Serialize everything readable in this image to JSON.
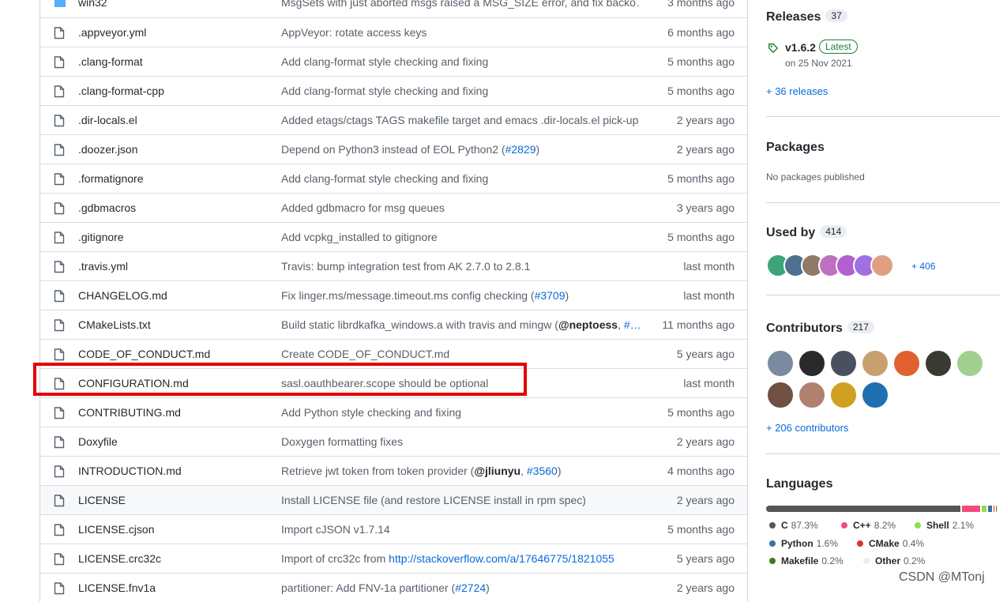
{
  "files": [
    {
      "name": "win32",
      "message": "MsgSets with just aborted msgs raised a MSG_SIZE error, and fix backo…",
      "age": "3 months ago",
      "type": "folder"
    },
    {
      "name": ".appveyor.yml",
      "message": "AppVeyor: rotate access keys",
      "age": "6 months ago"
    },
    {
      "name": ".clang-format",
      "message": "Add clang-format style checking and fixing",
      "age": "5 months ago"
    },
    {
      "name": ".clang-format-cpp",
      "message": "Add clang-format style checking and fixing",
      "age": "5 months ago"
    },
    {
      "name": ".dir-locals.el",
      "message": "Added etags/ctags TAGS makefile target and emacs .dir-locals.el pick-up",
      "age": "2 years ago"
    },
    {
      "name": ".doozer.json",
      "message": "Depend on Python3 instead of EOL Python2 (",
      "link": "#2829",
      "message_end": ")",
      "age": "2 years ago"
    },
    {
      "name": ".formatignore",
      "message": "Add clang-format style checking and fixing",
      "age": "5 months ago"
    },
    {
      "name": ".gdbmacros",
      "message": "Added gdbmacro for msg queues",
      "age": "3 years ago"
    },
    {
      "name": ".gitignore",
      "message": "Add vcpkg_installed to gitignore",
      "age": "5 months ago"
    },
    {
      "name": ".travis.yml",
      "message": "Travis: bump integration test from AK 2.7.0 to 2.8.1",
      "age": "last month"
    },
    {
      "name": "CHANGELOG.md",
      "message": "Fix linger.ms/message.timeout.ms config checking (",
      "link": "#3709",
      "message_end": ")",
      "age": "last month"
    },
    {
      "name": "CMakeLists.txt",
      "message": "Build static librdkafka_windows.a with travis and mingw (",
      "bold": "@neptoess",
      "message_mid": ", ",
      "link": "#…",
      "age": "11 months ago"
    },
    {
      "name": "CODE_OF_CONDUCT.md",
      "message": "Create CODE_OF_CONDUCT.md",
      "age": "5 years ago"
    },
    {
      "name": "CONFIGURATION.md",
      "message": "sasl.oauthbearer.scope should be optional",
      "age": "last month"
    },
    {
      "name": "CONTRIBUTING.md",
      "message": "Add Python style checking and fixing",
      "age": "5 months ago"
    },
    {
      "name": "Doxyfile",
      "message": "Doxygen formatting fixes",
      "age": "2 years ago"
    },
    {
      "name": "INTRODUCTION.md",
      "message": "Retrieve jwt token from token provider (",
      "bold": "@jliunyu",
      "message_mid": ", ",
      "link": "#3560",
      "message_end": ")",
      "age": "4 months ago"
    },
    {
      "name": "LICENSE",
      "message": "Install LICENSE file (and restore LICENSE install in rpm spec)",
      "age": "2 years ago",
      "hover": true
    },
    {
      "name": "LICENSE.cjson",
      "message": "Import cJSON v1.7.14",
      "age": "5 months ago"
    },
    {
      "name": "LICENSE.crc32c",
      "message": "Import of crc32c from ",
      "link": "http://stackoverflow.com/a/17646775/1821055",
      "age": "5 years ago"
    },
    {
      "name": "LICENSE.fnv1a",
      "message": "partitioner: Add FNV-1a partitioner (",
      "link": "#2724",
      "message_end": ")",
      "age": "2 years ago"
    }
  ],
  "sidebar": {
    "releases": {
      "title": "Releases",
      "count": "37",
      "version": "v1.6.2",
      "badge": "Latest",
      "date": "on 25 Nov 2021",
      "more": "+ 36 releases"
    },
    "packages": {
      "title": "Packages",
      "note": "No packages published"
    },
    "used_by": {
      "title": "Used by",
      "count": "414",
      "more": "+ 406"
    },
    "contributors": {
      "title": "Contributors",
      "count": "217",
      "more": "+ 206 contributors"
    },
    "languages": {
      "title": "Languages",
      "items": [
        {
          "name": "C",
          "pct": "87.3%",
          "value": 87.3,
          "color": "#555555"
        },
        {
          "name": "C++",
          "pct": "8.2%",
          "value": 8.2,
          "color": "#f34b7d"
        },
        {
          "name": "Shell",
          "pct": "2.1%",
          "value": 2.1,
          "color": "#89e051"
        },
        {
          "name": "Python",
          "pct": "1.6%",
          "value": 1.6,
          "color": "#3572A5"
        },
        {
          "name": "CMake",
          "pct": "0.4%",
          "value": 0.4,
          "color": "#DA3434"
        },
        {
          "name": "Makefile",
          "pct": "0.2%",
          "value": 0.2,
          "color": "#427819"
        },
        {
          "name": "Other",
          "pct": "0.2%",
          "value": 0.2,
          "color": "#ededed"
        }
      ]
    }
  },
  "watermark": "CSDN @MTonj",
  "colors": {
    "highlight": "#e60000",
    "link": "#0969da"
  }
}
